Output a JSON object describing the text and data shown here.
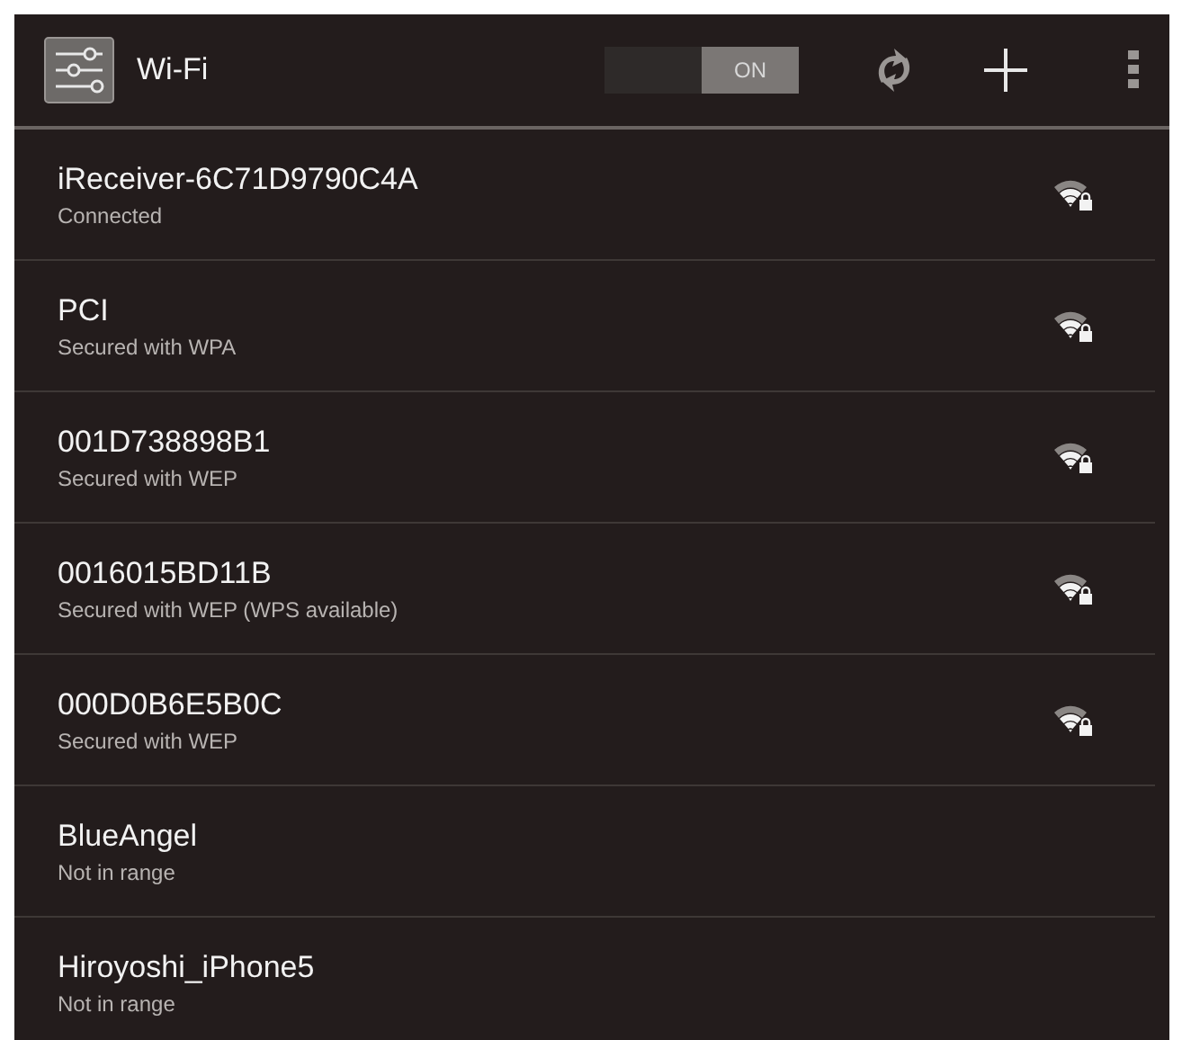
{
  "action_bar": {
    "title": "Wi-Fi",
    "toggle": {
      "label": "ON",
      "on": true
    }
  },
  "networks": [
    {
      "name": "iReceiver-6C71D9790C4A",
      "status": "Connected",
      "kind": "secured"
    },
    {
      "name": "PCI",
      "status": "Secured with WPA",
      "kind": "secured"
    },
    {
      "name": "001D738898B1",
      "status": "Secured with WEP",
      "kind": "secured"
    },
    {
      "name": "0016015BD11B",
      "status": "Secured with WEP (WPS available)",
      "kind": "secured"
    },
    {
      "name": "000D0B6E5B0C",
      "status": "Secured with WEP",
      "kind": "secured"
    },
    {
      "name": "BlueAngel",
      "status": "Not in range",
      "kind": "out_of_range"
    },
    {
      "name": "Hiroyoshi_iPhone5",
      "status": "Not in range",
      "kind": "out_of_range"
    }
  ]
}
